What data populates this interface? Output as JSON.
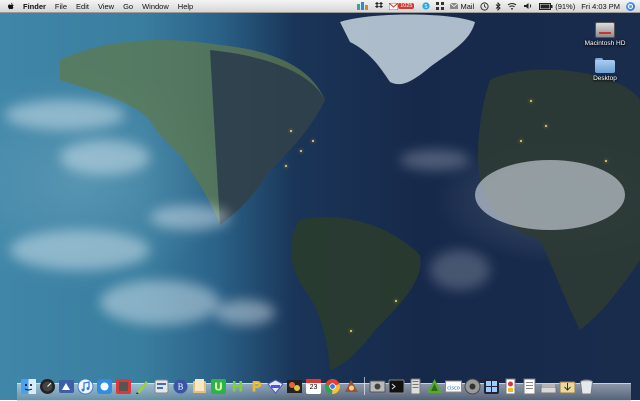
{
  "menubar": {
    "app_name": "Finder",
    "menus": [
      "File",
      "Edit",
      "View",
      "Go",
      "Window",
      "Help"
    ],
    "status": {
      "mail_count": "1025",
      "mail_label": "Mail",
      "battery": "(91%)",
      "clock": "Fri 4:03 PM"
    }
  },
  "desktop_icons": [
    {
      "label": "Macintosh HD",
      "icon": "hard-drive-icon"
    },
    {
      "label": "Desktop",
      "icon": "folder-icon"
    }
  ],
  "dock": {
    "calendar_day": "23",
    "apps": [
      "finder-icon",
      "dashboard-icon",
      "app-icon-1",
      "itunes-icon",
      "app-icon-2",
      "app-icon-3",
      "pen-icon",
      "app-icon-4",
      "book-icon",
      "upwork-icon",
      "hp-icon",
      "dictionary-icon",
      "news-icon",
      "photo-icon",
      "calendar-icon",
      "chrome-icon",
      "app-icon-5",
      "screenshot-icon",
      "terminal-icon",
      "app-icon-6",
      "app-icon-7",
      "cisco-icon",
      "utility-icon",
      "expose-icon",
      "app-icon-8",
      "docs-icon",
      "downloads-icon",
      "trash-icon"
    ],
    "cisco_label": "cisco"
  }
}
